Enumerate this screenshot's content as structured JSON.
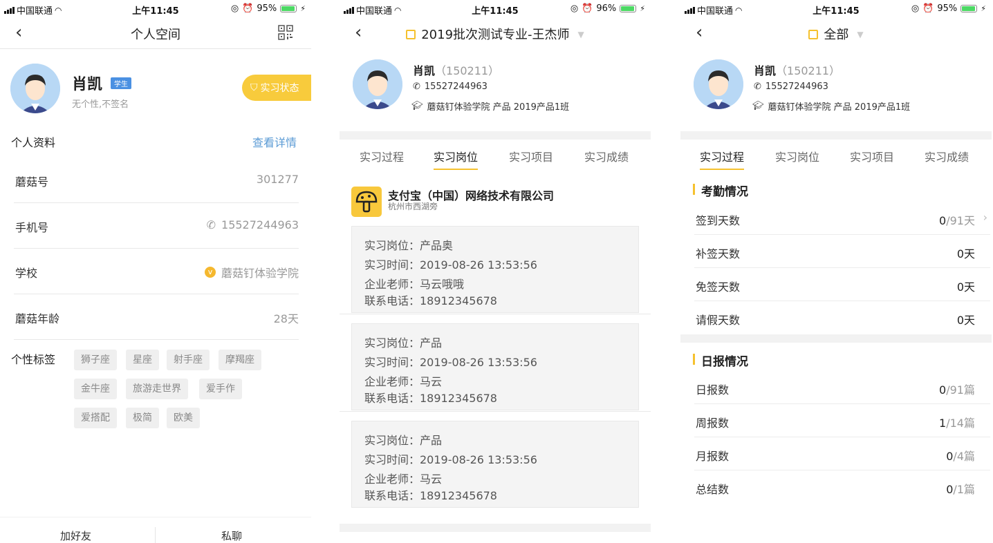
{
  "status": {
    "carrier": "中国联通",
    "time": "上午11:45",
    "s1_battery": "95%",
    "s2_battery": "96%",
    "s3_battery": "95%"
  },
  "screen1": {
    "title": "个人空间",
    "user": {
      "name": "肖凯",
      "role_badge": "学生",
      "signature": "无个性,不签名"
    },
    "status_button": "实习状态",
    "profile_title": "个人资料",
    "details_link": "查看详情",
    "rows": [
      {
        "key": "蘑菇号",
        "value": "301277"
      },
      {
        "key": "手机号",
        "value": "15527244963"
      },
      {
        "key": "学校",
        "value": "蘑菇钉体验学院"
      },
      {
        "key": "蘑菇年龄",
        "value": "28天"
      }
    ],
    "tags_label": "个性标签",
    "tags": [
      "狮子座",
      "星座",
      "射手座",
      "摩羯座",
      "金牛座",
      "旅游走世界",
      "爱手作",
      "爱搭配",
      "极简",
      "欧美"
    ],
    "actions": {
      "add_friend": "加好友",
      "chat": "私聊"
    }
  },
  "screen2": {
    "title": "2019批次测试专业-王杰师",
    "user": {
      "name": "肖凯",
      "sid": "（150211）",
      "phone": "15527244963",
      "school": "蘑菇钉体验学院 产品 2019产品1班"
    },
    "tabs": [
      "实习过程",
      "实习岗位",
      "实习项目",
      "实习成绩"
    ],
    "active_tab": "实习岗位",
    "company": {
      "name": "支付宝（中国）网络技术有限公司",
      "address": "杭州市西湖旁"
    },
    "cards": [
      {
        "position": "实习岗位：产品奥",
        "time": "实习时间：2019-08-26 13:53:56",
        "teacher": "企业老师：马云哦哦",
        "phone": "联系电话：18912345678"
      },
      {
        "position": "实习岗位：产品",
        "time": "实习时间：2019-08-26 13:53:56",
        "teacher": "企业老师：马云",
        "phone": "联系电话：18912345678"
      },
      {
        "position": "实习岗位：产品",
        "time": "实习时间：2019-08-26 13:53:56",
        "teacher": "企业老师：马云",
        "phone": "联系电话：18912345678"
      }
    ]
  },
  "screen3": {
    "title": "全部",
    "user": {
      "name": "肖凯",
      "sid": "（150211）",
      "phone": "15527244963",
      "school": "蘑菇钉体验学院 产品 2019产品1班"
    },
    "tabs": [
      "实习过程",
      "实习岗位",
      "实习项目",
      "实习成绩"
    ],
    "active_tab": "实习过程",
    "attendance_title": "考勤情况",
    "attendance": [
      {
        "key": "签到天数",
        "num": "0",
        "rest": "/91天"
      },
      {
        "key": "补签天数",
        "num": "0天",
        "rest": ""
      },
      {
        "key": "免签天数",
        "num": "0天",
        "rest": ""
      },
      {
        "key": "请假天数",
        "num": "0天",
        "rest": ""
      }
    ],
    "report_title": "日报情况",
    "reports": [
      {
        "key": "日报数",
        "num": "0",
        "rest": "/91篇"
      },
      {
        "key": "周报数",
        "num": "1",
        "rest": "/14篇"
      },
      {
        "key": "月报数",
        "num": "0",
        "rest": "/4篇"
      },
      {
        "key": "总结数",
        "num": "0",
        "rest": "/1篇"
      }
    ]
  },
  "icons": {
    "back": "back-arrow-icon",
    "qr": "qr-code-icon",
    "phone": "phone-icon",
    "school": "graduation-cap-icon",
    "calendar": "calendar-icon"
  },
  "colors": {
    "accent_yellow": "#f5c12e",
    "link_blue": "#5b9bd5",
    "avatar_bg": "#b8d8f5"
  }
}
